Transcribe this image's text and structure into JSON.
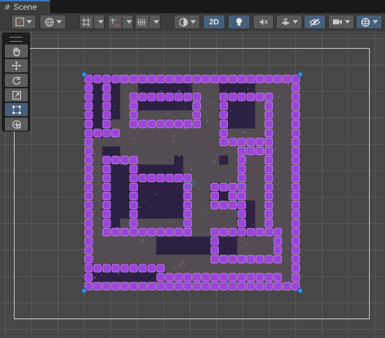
{
  "tab": {
    "label": "Scene"
  },
  "toolbar": {
    "draw_mode_icon": "draw-mode-icon",
    "global_icon": "globe-icon",
    "grid_snap_icon": "grid-snap-icon",
    "increment_snap_icon": "increment-snap-icon",
    "grid_visibility_icon": "grid-visibility-icon",
    "shading_icon": "shading-icon",
    "two_d_label": "2D",
    "lighting_icon": "light-bulb-icon",
    "audio_icon": "audio-muted-icon",
    "effects_icon": "effects-icon",
    "visibility_icon": "hidden-eye-icon",
    "camera_icon": "camera-icon",
    "gizmos_icon": "gizmos-globe-icon"
  },
  "tools": [
    {
      "name": "hand-tool",
      "active": false
    },
    {
      "name": "move-tool",
      "active": false
    },
    {
      "name": "rotate-tool",
      "active": false
    },
    {
      "name": "scale-tool",
      "active": false
    },
    {
      "name": "rect-tool",
      "active": true
    },
    {
      "name": "transform-tool",
      "active": false
    }
  ],
  "colors": {
    "accent": "#46607c",
    "selection_handle": "#3f8fe0",
    "tile_wall": "#9a45d8",
    "tile_wall_light": "#c57bf2",
    "tile_pit": "#2c2142",
    "tile_floor": "#534c52"
  }
}
